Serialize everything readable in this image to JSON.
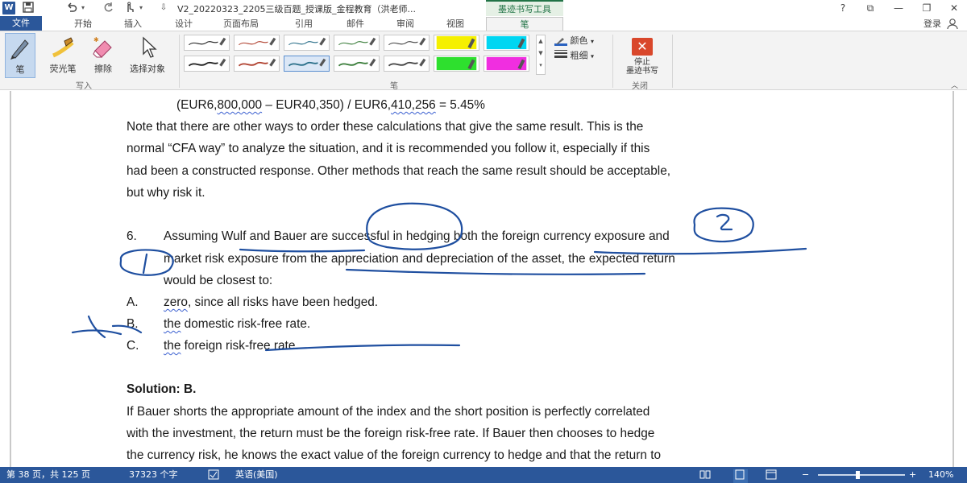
{
  "titlebar": {
    "app_logo": "W",
    "doc_title": "V2_20220323_2205三级百题_授课版_金程教育（洪老师...",
    "context_tab": "墨迹书写工具",
    "help": "?",
    "restore_ribbon": "⧉",
    "minimize": "—",
    "maximize": "❐",
    "close": "✕"
  },
  "tabs": {
    "file": "文件",
    "home": "开始",
    "insert": "插入",
    "design": "设计",
    "layout": "页面布局",
    "references": "引用",
    "mailings": "邮件",
    "review": "审阅",
    "view": "视图",
    "pen": "笔",
    "login": "登录"
  },
  "ribbon": {
    "pen_label": "笔",
    "highlighter_label": "荧光笔",
    "eraser_label": "擦除",
    "select_label": "选择对象",
    "group_write": "写入",
    "group_pens": "笔",
    "color_label": "颜色",
    "thickness_label": "粗细",
    "stop_label_1": "停止",
    "stop_label_2": "墨迹书写",
    "group_close": "关闭",
    "pen_colors": [
      "#1f1f1f",
      "#b0412f",
      "#2a6f89",
      "#3a7d3a",
      "#444444",
      "#f5f000",
      "#00d6f2",
      "#1f1f1f",
      "#b0412f",
      "#2a6f89",
      "#3a7d3a",
      "#444444",
      "#2ee02e",
      "#f02ee0"
    ]
  },
  "document": {
    "formula": {
      "pre": "(EUR6,",
      "a": "800,000",
      "mid": " – EUR40,350) / EUR6,",
      "b": "410,256",
      "post": " = 5.45%"
    },
    "note_lines": [
      "Note that there are other ways to order these calculations that give the same result. This is the",
      "normal “CFA way” to analyze the situation, and it is recommended you follow it, especially if this",
      "had been a constructed response. Other methods that reach the same result should be acceptable,",
      "but why risk it."
    ],
    "q_number": "6.",
    "q_lines": [
      "Assuming Wulf and Bauer are successful in hedging both the foreign currency exposure and",
      "market risk exposure from the appreciation and depreciation of the asset, the expected return",
      "would be closest to:"
    ],
    "options": [
      {
        "letter": "A.",
        "lead": "zero",
        "rest": ", since all risks have been hedged."
      },
      {
        "letter": "B.",
        "lead": "the",
        "rest": " domestic risk-free rate."
      },
      {
        "letter": "C.",
        "lead": "the",
        "rest": " foreign risk-free rate."
      }
    ],
    "solution_title": "Solution: B.",
    "solution_lines": [
      "If Bauer shorts the appropriate amount of the index and the short position is perfectly correlated",
      "with the investment, the return must be the foreign risk-free rate. If Bauer then chooses to hedge",
      "the currency risk, he knows the exact value of the foreign currency to hedge and that the return to"
    ],
    "ink_color": "#1f4fa0"
  },
  "statusbar": {
    "page": "第 38 页，共 125 页",
    "words": "37323 个字",
    "language": "英语(美国)",
    "zoom_minus": "−",
    "zoom_plus": "+",
    "zoom_level": "140%",
    "zoom_fraction": 0.45
  }
}
